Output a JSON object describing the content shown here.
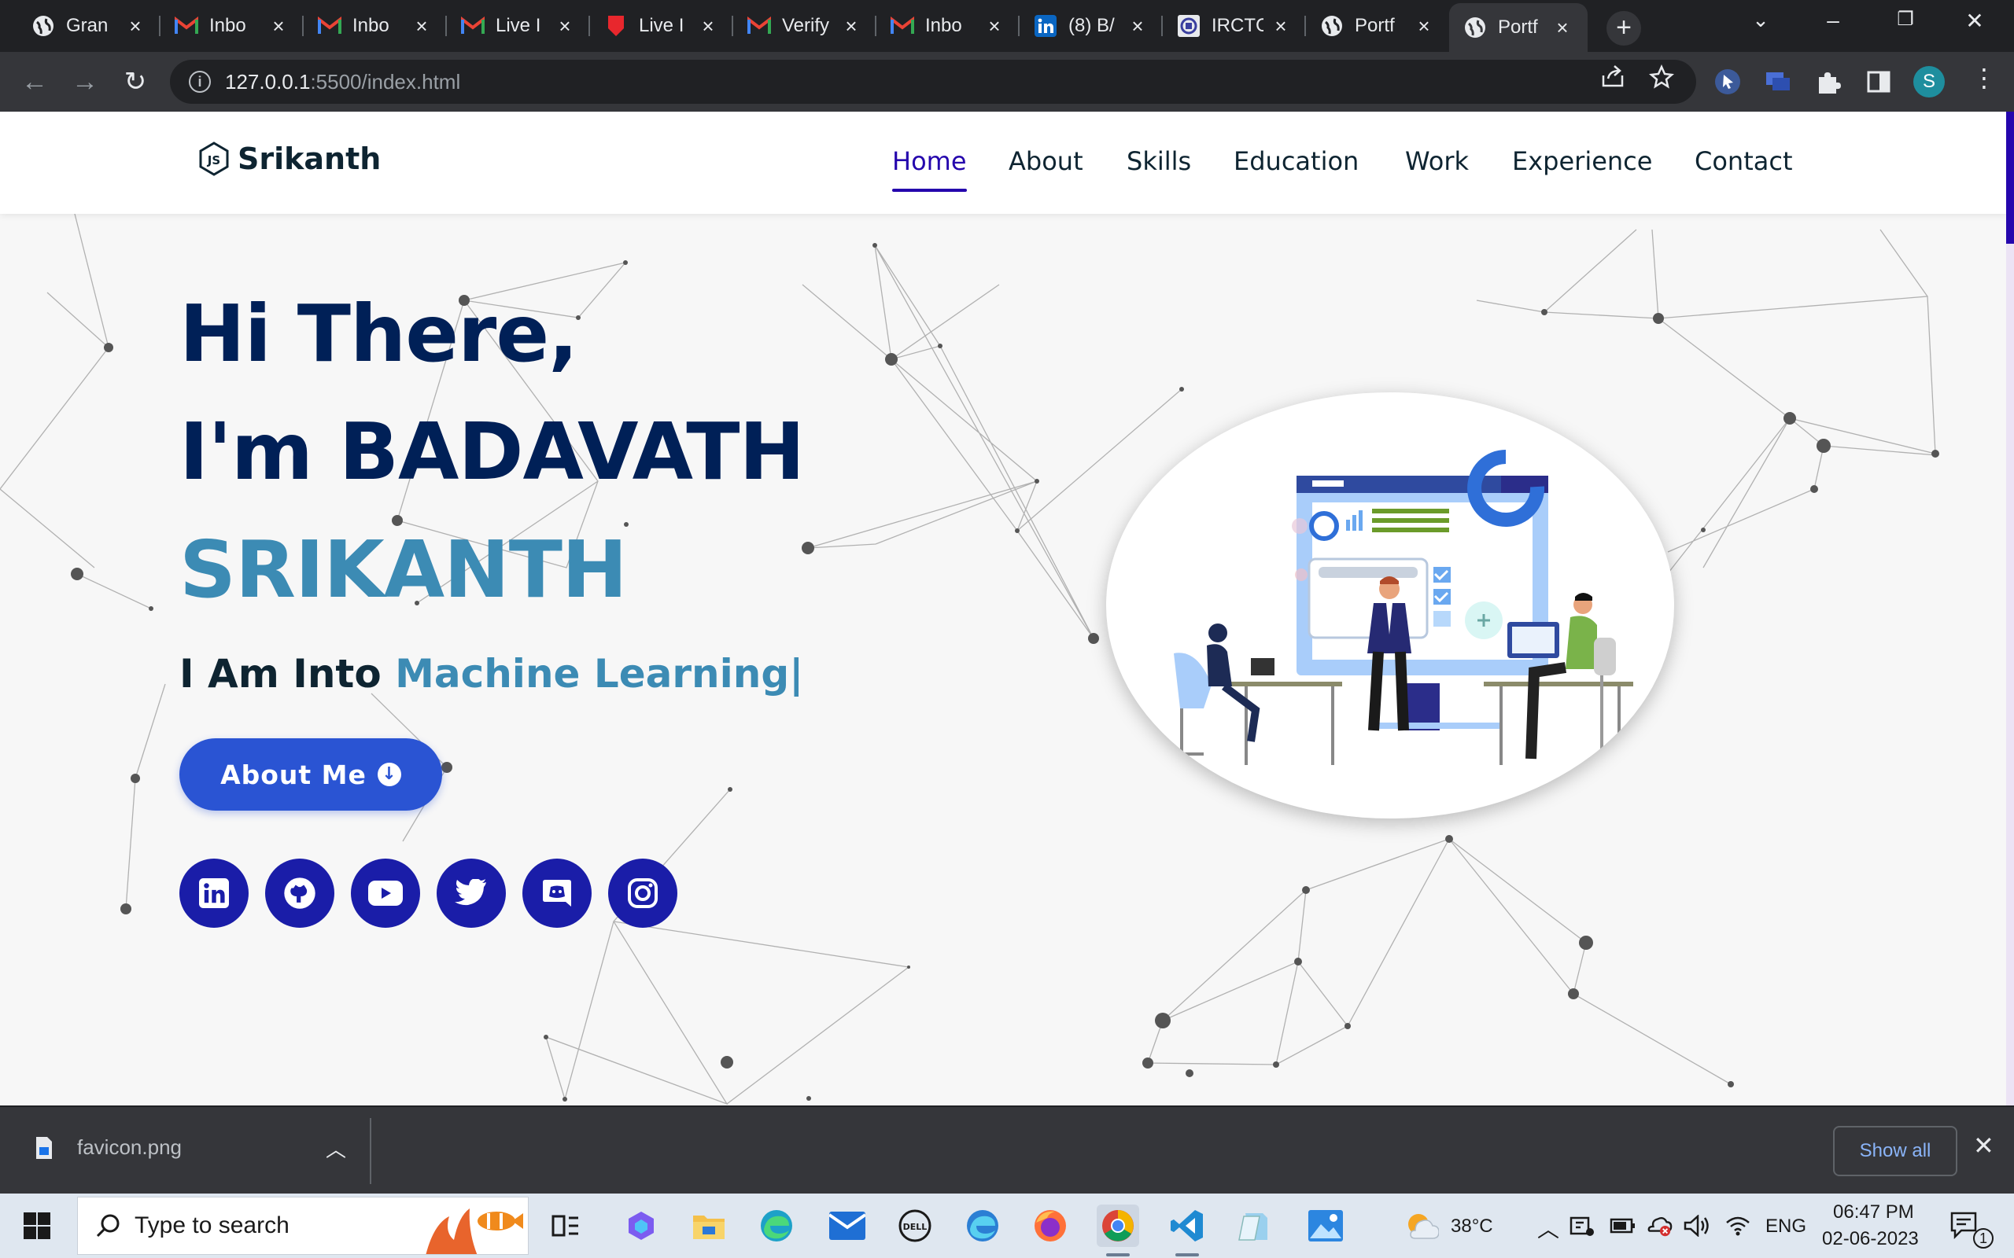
{
  "browser": {
    "tabs": [
      {
        "title": "Gran",
        "icon": "globe-icon"
      },
      {
        "title": "Inbo",
        "icon": "gmail-icon"
      },
      {
        "title": "Inbo",
        "icon": "gmail-icon"
      },
      {
        "title": "Live I",
        "icon": "gmail-icon"
      },
      {
        "title": "Live I",
        "icon": "red-shield-icon"
      },
      {
        "title": "Verify",
        "icon": "gmail-icon"
      },
      {
        "title": "Inbo",
        "icon": "gmail-icon"
      },
      {
        "title": "(8) B/",
        "icon": "linkedin-icon"
      },
      {
        "title": "IRCTC",
        "icon": "irctc-icon"
      },
      {
        "title": "Portf",
        "icon": "globe-icon"
      },
      {
        "title": "Portf",
        "icon": "globe-icon"
      }
    ],
    "active_tab": 10,
    "url_host": "127.0.0.1",
    "url_path": ":5500/index.html",
    "profile_initial": "S"
  },
  "site": {
    "logo_text": "Srikanth",
    "logo_mark": "JS",
    "nav": [
      "Home",
      "About",
      "Skills",
      "Education",
      "Work",
      "Experience",
      "Contact"
    ],
    "active_nav": "Home",
    "hero": {
      "line1": "Hi There,",
      "line2": "I'm BADAVATH",
      "line3": "SRIKANTH",
      "typed_prefix": "I Am Into ",
      "typed_word": "Machine Learning|",
      "button_label": "About Me"
    },
    "socials": [
      "linkedin-icon",
      "github-icon",
      "youtube-icon",
      "twitter-icon",
      "discord-icon",
      "instagram-icon"
    ],
    "colors": {
      "navy": "#002057",
      "accent": "#3c8bb4",
      "button": "#2a54d3",
      "social": "#1a1da8",
      "nav_active": "#2506ad"
    }
  },
  "downloads": {
    "file": "favicon.png",
    "show_all": "Show all"
  },
  "taskbar": {
    "search_placeholder": "Type to search",
    "temperature": "38°C",
    "language": "ENG",
    "time": "06:47 PM",
    "date": "02-06-2023",
    "notification_count": "1"
  }
}
